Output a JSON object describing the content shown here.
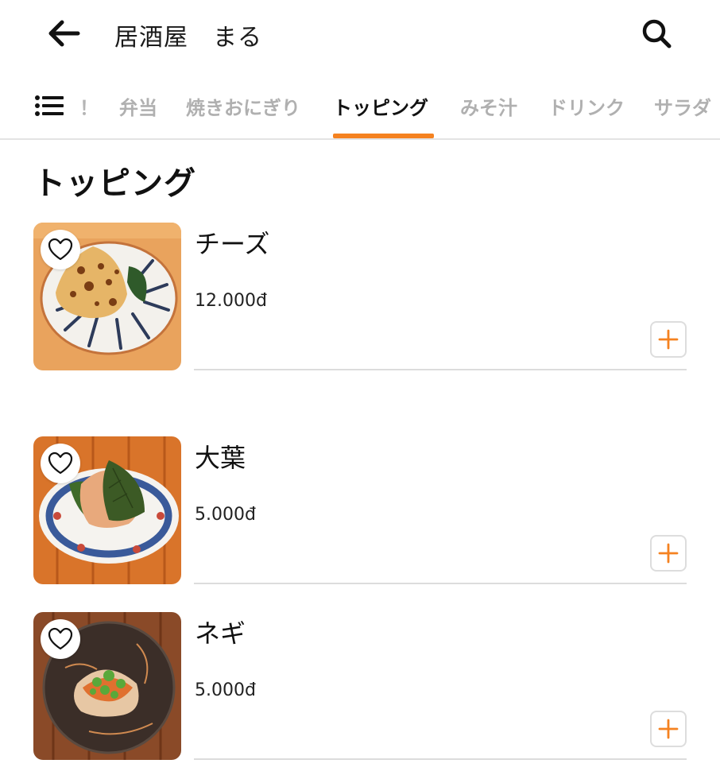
{
  "header": {
    "title": "居酒屋　まる",
    "back_icon": "arrow-left-icon",
    "search_icon": "search-icon"
  },
  "tabs": {
    "menu_icon": "list-icon",
    "menu_suffix": "！",
    "items": [
      {
        "label": "弁当"
      },
      {
        "label": "焼きおにぎり"
      },
      {
        "label": "トッピング"
      },
      {
        "label": "みそ汁"
      },
      {
        "label": "ドリンク"
      },
      {
        "label": "サラダ"
      }
    ],
    "active_index": 2,
    "accent_color": "#f58220"
  },
  "section": {
    "title": "トッピング"
  },
  "items": [
    {
      "name": "チーズ",
      "price": "12.000đ"
    },
    {
      "name": "大葉",
      "price": "5.000đ"
    },
    {
      "name": "ネギ",
      "price": "5.000đ"
    }
  ]
}
